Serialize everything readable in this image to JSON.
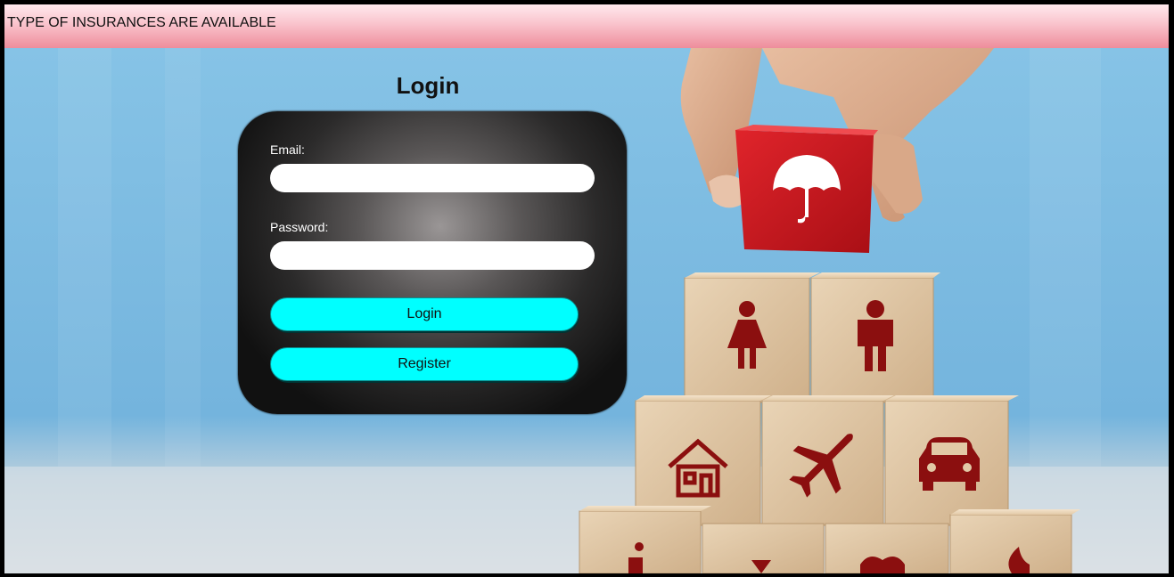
{
  "header": {
    "title": "TYPE OF INSURANCES ARE AVAILABLE"
  },
  "login": {
    "title": "Login",
    "email_label": "Email:",
    "email_value": "",
    "password_label": "Password:",
    "password_value": "",
    "login_button": "Login",
    "register_button": "Register"
  },
  "hero": {
    "icons": [
      "umbrella-icon",
      "woman-icon",
      "man-icon",
      "house-icon",
      "airplane-icon",
      "car-icon",
      "person-icon",
      "heart-icon",
      "fire-icon"
    ]
  },
  "colors": {
    "header_gradient_top": "#ffe9ee",
    "header_gradient_bottom": "#ee8d9b",
    "button": "#00ffff",
    "card": "#2b2a2a",
    "icon_red": "#8b0f0f",
    "cube_red": "#c8161d"
  }
}
